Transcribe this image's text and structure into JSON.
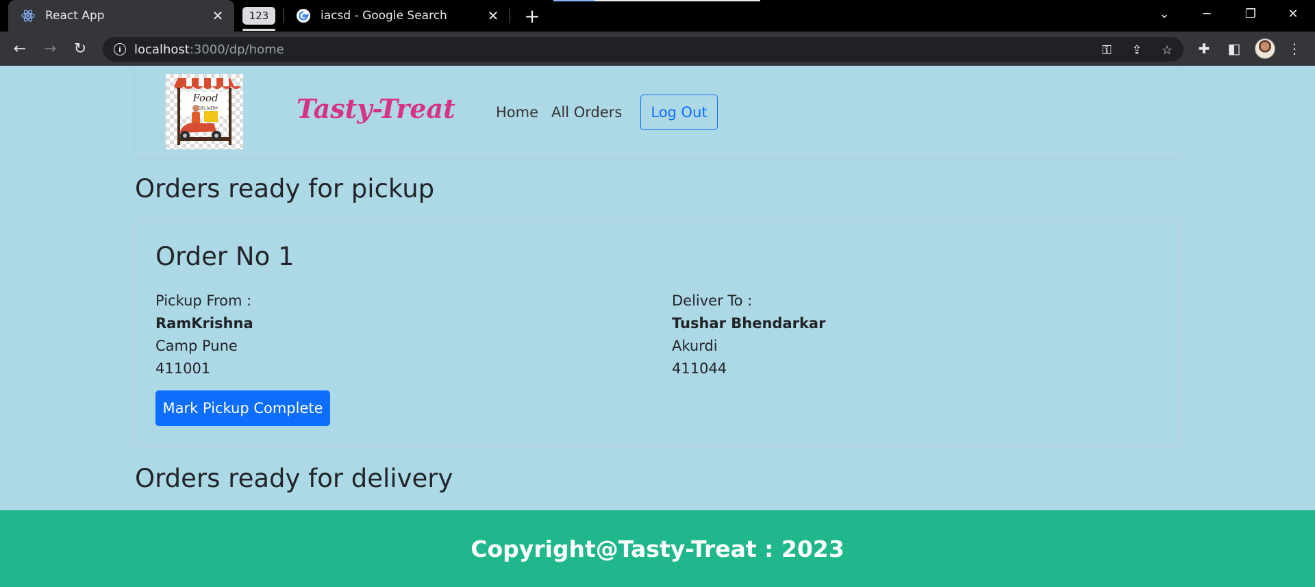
{
  "browser": {
    "tabs": [
      {
        "title": "React App",
        "icon": "react-icon",
        "active": true
      },
      {
        "title": "iacsd - Google Search",
        "icon": "google-icon",
        "active": false
      }
    ],
    "tab_group_label": "123",
    "url_host": "localhost",
    "url_path": ":3000/dp/home"
  },
  "navbar": {
    "logo_text": "Food DELIVERY",
    "brand": "Tasty-Treat",
    "links": [
      "Home",
      "All Orders"
    ],
    "logout_label": "Log Out"
  },
  "pickup_section": {
    "title": "Orders ready for pickup",
    "order": {
      "title": "Order No 1",
      "pickup": {
        "label": "Pickup From :",
        "name": "RamKrishna",
        "area": "Camp Pune",
        "pincode": "411001"
      },
      "deliver": {
        "label": "Deliver To :",
        "name": "Tushar Bhendarkar",
        "area": "Akurdi",
        "pincode": "411044"
      },
      "action_label": "Mark Pickup Complete"
    }
  },
  "delivery_section": {
    "title": "Orders ready for delivery"
  },
  "footer": {
    "text": "Copyright@Tasty-Treat : 2023"
  },
  "colors": {
    "page_bg": "#add8e6",
    "brand": "#d63384",
    "primary": "#0d6efd",
    "footer_bg": "#20b78c"
  }
}
